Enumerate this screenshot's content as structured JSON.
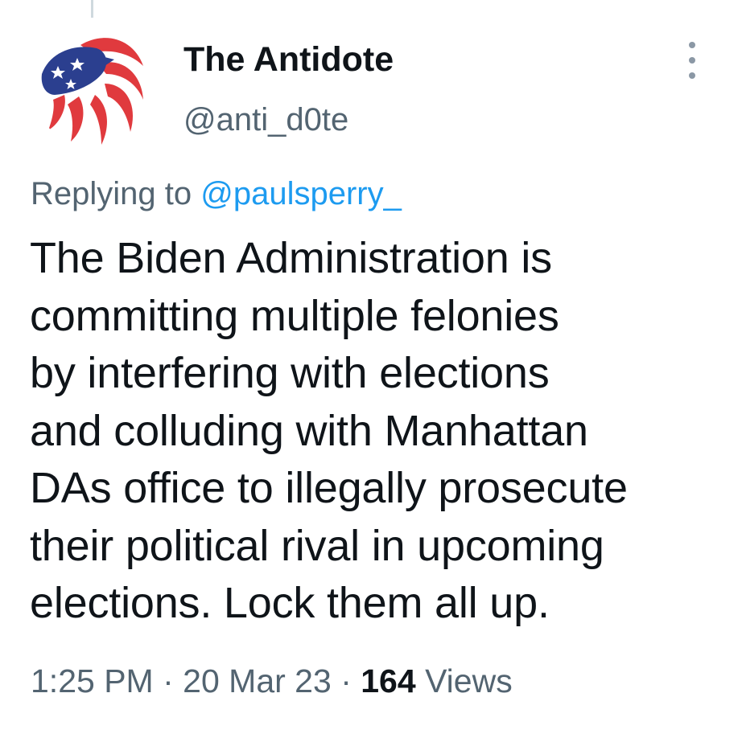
{
  "author": {
    "display_name": "The Antidote",
    "handle": "@anti_d0te",
    "avatar_icon": "patriotic-eagle-flag-icon"
  },
  "reply": {
    "prefix": "Replying to",
    "target": "@paulsperry_"
  },
  "tweet": {
    "lines": [
      "The Biden Administration is",
      "committing multiple felonies",
      "by interfering with elections",
      "and colluding with Manhattan",
      "DAs office to illegally prosecute",
      "their political rival in upcoming",
      "elections. Lock them all up."
    ]
  },
  "meta": {
    "time": "1:25 PM",
    "separator": "·",
    "date": "20 Mar 23",
    "views_count": "164",
    "views_label": "Views"
  },
  "colors": {
    "text": "#0f1419",
    "secondary": "#536471",
    "link": "#1d9bf0",
    "flag_blue": "#2b3f8f",
    "flag_red": "#e03a3e"
  },
  "icons": {
    "more": "more-vertical-icon"
  }
}
